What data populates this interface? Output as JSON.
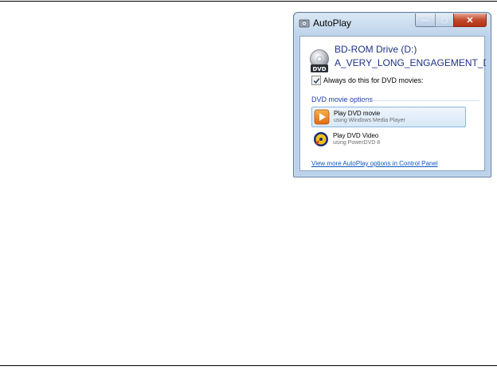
{
  "window": {
    "title": "AutoPlay",
    "buttons": {
      "minimize": "—",
      "maximize": "▢",
      "close": "✕"
    }
  },
  "drive": {
    "name": "BD-ROM Drive (D:)",
    "disc_label": "A_VERY_LONG_ENGAGEMENT_DISC",
    "icon": "dvd-disc-icon",
    "icon_text": "DVD"
  },
  "always_do": {
    "label": "Always do this for DVD movies:",
    "checked": true
  },
  "section": {
    "title": "DVD movie options"
  },
  "options": [
    {
      "title": "Play DVD movie",
      "subtitle": "using Windows Media Player",
      "icon": "windows-media-player-icon",
      "selected": true
    },
    {
      "title": "Play DVD Video",
      "subtitle": "using PowerDVD 8",
      "icon": "powerdvd-icon",
      "selected": false
    }
  ],
  "footer_link": "View more AutoPlay options in Control Panel",
  "colors": {
    "accent_text": "#1e3287",
    "link": "#0b56c5",
    "selection_border": "#8bb5e0",
    "close_button": "#c2492c"
  }
}
